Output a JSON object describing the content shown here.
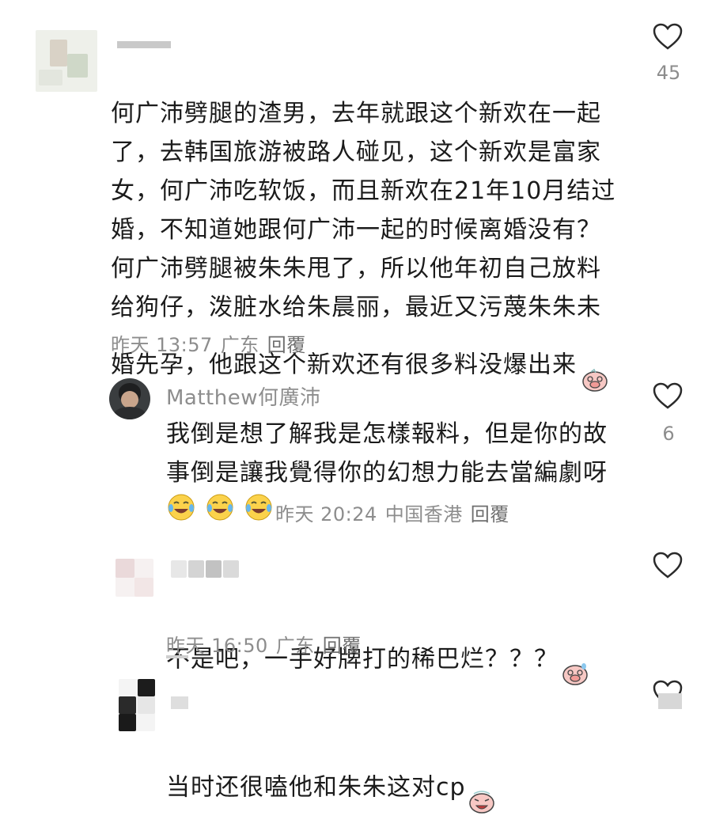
{
  "comments": [
    {
      "username": "",
      "body": "何广沛劈腿的渣男，去年就跟这个新欢在一起\n了，去韩国旅游被路人碰见，这个新欢是富家\n女，何广沛吃软饭，而且新欢在21年10月结过\n婚，不知道她跟何广沛一起的时候离婚没有？\n何广沛劈腿被朱朱甩了，所以他年初自己放料\n给狗仔，泼脏水给朱晨丽，最近又污蔑朱朱未\n婚先孕，他跟这个新欢还有很多料没爆出来",
      "time": "昨天 13:57",
      "location": "广东",
      "reply": "回覆",
      "likes": "45",
      "emoji": "pig-face-icon"
    },
    {
      "username": "Matthew何廣沛",
      "body": "我倒是想了解我是怎樣報料，但是你的故\n事倒是讓我覺得你的幻想力能去當編劇呀",
      "time": "昨天 20:24",
      "location": "中国香港",
      "reply": "回覆",
      "likes": "6",
      "emoji": "tears-of-joy-icon"
    },
    {
      "username": "",
      "body": "不是吧，一手好牌打的稀巴烂？？？",
      "time": "昨天 16:50",
      "location": "广东",
      "reply": "回覆",
      "likes": "",
      "emoji": "pig-sweat-icon"
    },
    {
      "username": "",
      "body": "当时还很嗑他和朱朱这对cp",
      "time": "",
      "location": "",
      "reply": "",
      "likes": "",
      "emoji": "pig-cry-icon"
    }
  ],
  "colors": {
    "text": "#1b1b1b",
    "meta": "#8d8d8d",
    "heart": "#2a2a2a"
  }
}
